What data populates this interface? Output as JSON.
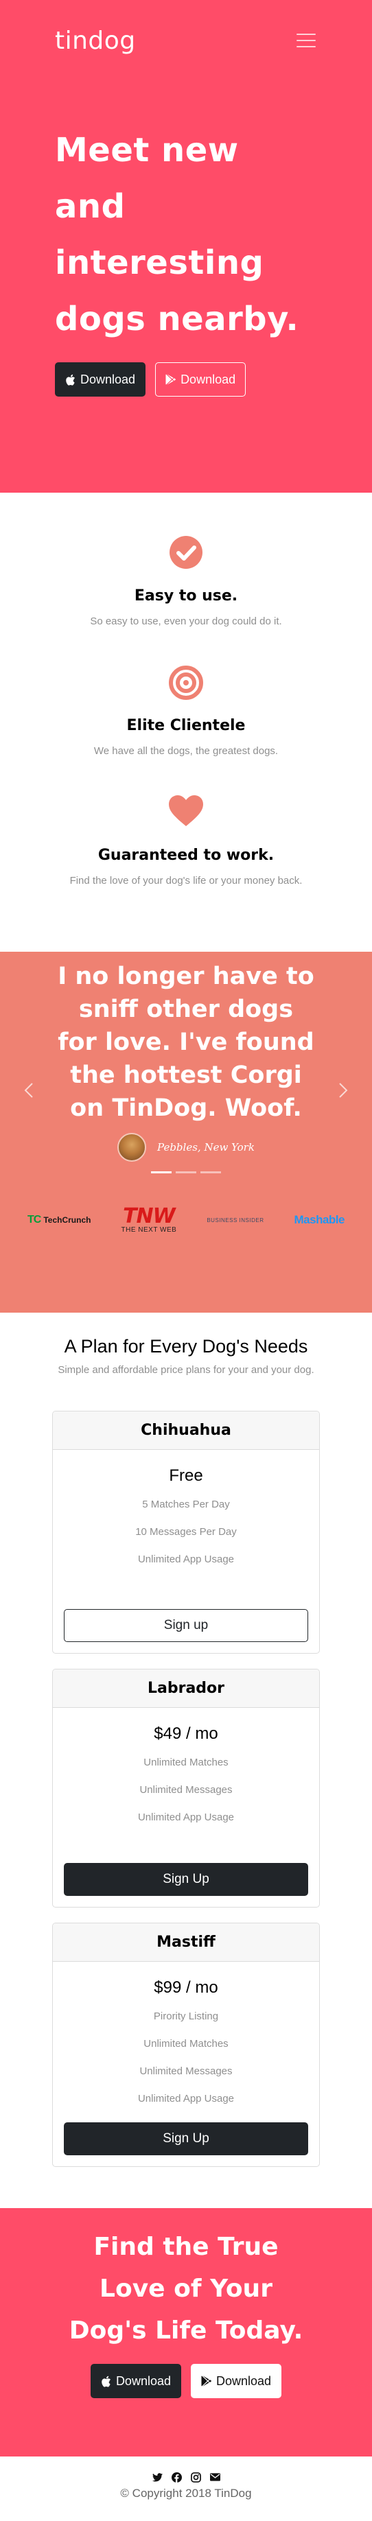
{
  "brand": {
    "name": "tindog"
  },
  "hero": {
    "title": "Meet new and interesting dogs nearby.",
    "apple_download": "Download",
    "play_download": "Download"
  },
  "features": [
    {
      "icon": "check-circle-icon",
      "title": "Easy to use.",
      "text": "So easy to use, even your dog could do it."
    },
    {
      "icon": "bullseye-icon",
      "title": "Elite Clientele",
      "text": "We have all the dogs, the greatest dogs."
    },
    {
      "icon": "heart-icon",
      "title": "Guaranteed to work.",
      "text": "Find the love of your dog's life or your money back."
    }
  ],
  "testimonial": {
    "quote": "I no longer have to sniff other dogs for love. I've found the hottest Corgi on TinDog. Woof.",
    "author": "Pebbles, New York"
  },
  "press": {
    "techcrunch": "TechCrunch",
    "tnw_big": "TNW",
    "tnw_small": "THE NEXT WEB",
    "business_insider": "BUSINESS INSIDER",
    "mashable": "Mashable"
  },
  "pricing": {
    "title": "A Plan for Every Dog's Needs",
    "subtitle": "Simple and affordable price plans for your and your dog.",
    "plans": [
      {
        "name": "Chihuahua",
        "price": "Free",
        "features": [
          "5 Matches Per Day",
          "10 Messages Per Day",
          "Unlimited App Usage"
        ],
        "button": "Sign up"
      },
      {
        "name": "Labrador",
        "price": "$49 / mo",
        "features": [
          "Unlimited Matches",
          "Unlimited Messages",
          "Unlimited App Usage"
        ],
        "button": "Sign Up"
      },
      {
        "name": "Mastiff",
        "price": "$99 / mo",
        "features": [
          "Pirority Listing",
          "Unlimited Matches",
          "Unlimited Messages",
          "Unlimited App Usage"
        ],
        "button": "Sign Up"
      }
    ]
  },
  "cta": {
    "title": "Find the True Love of Your Dog's Life Today.",
    "apple_download": "Download",
    "play_download": "Download"
  },
  "footer": {
    "copyright": "© Copyright 2018 TinDog",
    "social": [
      "twitter-icon",
      "facebook-icon",
      "instagram-icon",
      "envelope-icon"
    ]
  },
  "colors": {
    "primary": "#ff4c68",
    "testimonial_bg": "#ef8172",
    "dark": "#212529",
    "muted": "#8f8f8f"
  }
}
